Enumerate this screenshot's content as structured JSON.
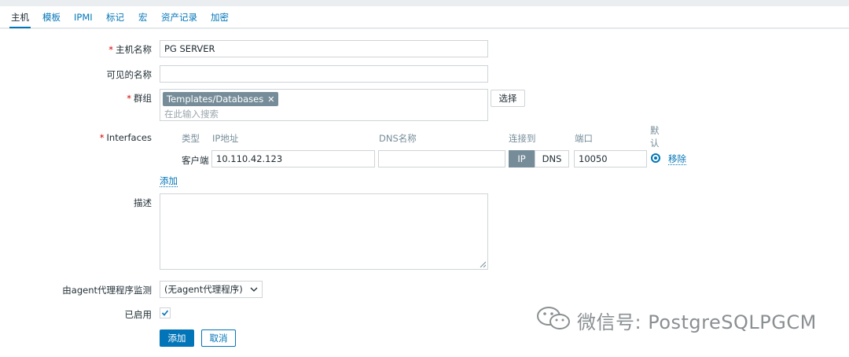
{
  "tabs": [
    {
      "label": "主机",
      "active": true
    },
    {
      "label": "模板"
    },
    {
      "label": "IPMI"
    },
    {
      "label": "标记"
    },
    {
      "label": "宏"
    },
    {
      "label": "资产记录"
    },
    {
      "label": "加密"
    }
  ],
  "form": {
    "host_name": {
      "label": "主机名称",
      "value": "PG SERVER"
    },
    "visible_name": {
      "label": "可见的名称",
      "value": ""
    },
    "groups": {
      "label": "群组",
      "selected": "Templates/Databases",
      "placeholder": "在此输入搜索",
      "select_button": "选择"
    },
    "interfaces": {
      "label": "Interfaces",
      "headers": {
        "type": "类型",
        "ip": "IP地址",
        "dns": "DNS名称",
        "connect": "连接到",
        "port": "端口",
        "default": "默认"
      },
      "row": {
        "type": "客户端",
        "ip": "10.110.42.123",
        "dns": "",
        "connect_ip": "IP",
        "connect_dns": "DNS",
        "port": "10050",
        "remove": "移除"
      },
      "add": "添加"
    },
    "description": {
      "label": "描述",
      "value": ""
    },
    "proxy": {
      "label": "由agent代理程序监测",
      "value": "(无agent代理程序)"
    },
    "enabled": {
      "label": "已启用",
      "checked": true
    },
    "buttons": {
      "add": "添加",
      "cancel": "取消"
    }
  },
  "watermark": {
    "text": "微信号: PostgreSQLPGCM"
  },
  "colors": {
    "accent": "#0275b8",
    "required": "#d40000",
    "chip": "#768d99"
  }
}
